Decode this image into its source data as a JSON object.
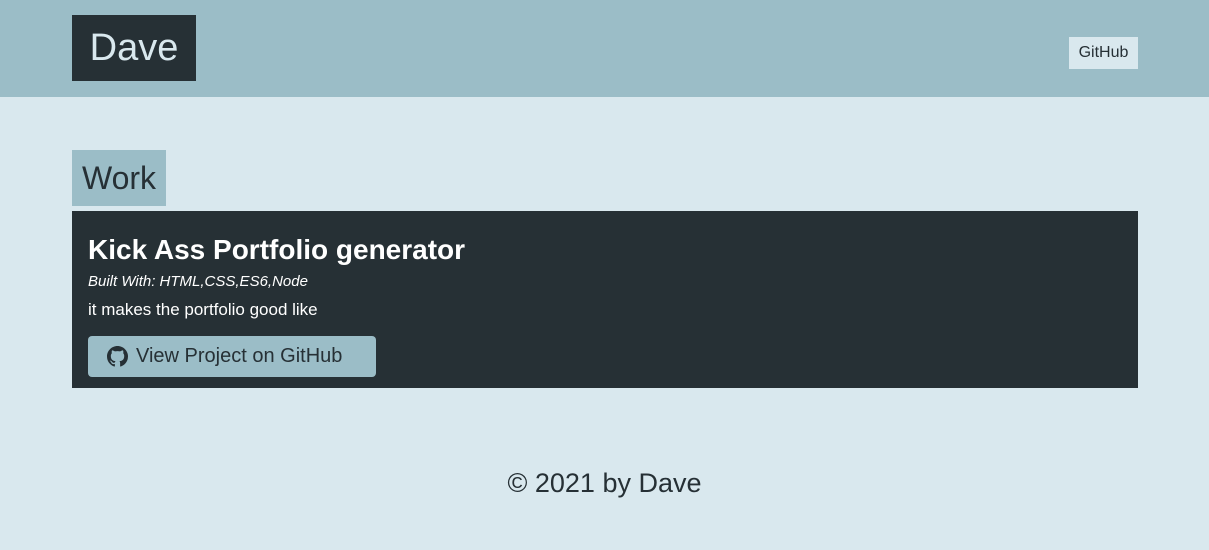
{
  "header": {
    "brand": "Dave",
    "nav_github": "GitHub"
  },
  "work": {
    "heading": "Work",
    "projects": [
      {
        "title": "Kick Ass Portfolio generator",
        "built_with": "Built With: HTML,CSS,ES6,Node",
        "description": "it makes the portfolio good like",
        "button_label": "View Project on GitHub",
        "button_icon": "github-icon"
      }
    ]
  },
  "footer": {
    "text": "© 2021 by Dave"
  },
  "colors": {
    "page_bg": "#d9e8ee",
    "header_bg": "#9bbdc7",
    "dark": "#263035"
  }
}
